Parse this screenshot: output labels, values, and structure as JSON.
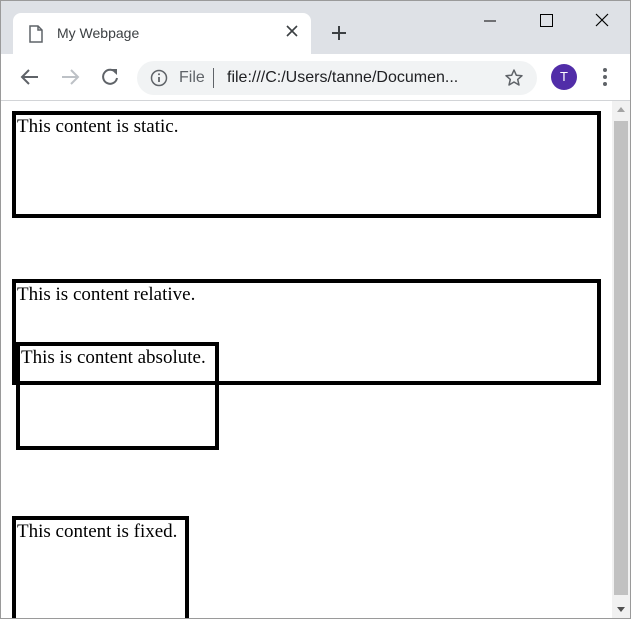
{
  "tab": {
    "title": "My Webpage",
    "page_icon": "page-icon",
    "close_icon": "close-icon"
  },
  "new_tab_icon": "plus-icon",
  "window_controls": [
    "minimize-icon",
    "maximize-icon",
    "close-icon"
  ],
  "toolbar": {
    "back_icon": "back-arrow-icon",
    "forward_icon": "forward-arrow-icon",
    "reload_icon": "reload-icon",
    "omnibox": {
      "info_icon": "info-icon",
      "scheme_label": "File",
      "url": "file:///C:/Users/tanne/Documen...",
      "bookmark_icon": "star-icon"
    },
    "avatar_initial": "T",
    "menu_icon": "three-dot-menu-icon"
  },
  "colors": {
    "avatar": "#512da8",
    "titlebar": "#dee1e6",
    "omnibox": "#f1f3f4"
  },
  "page": {
    "static_text": "This content is static.",
    "relative_text": "This is content relative.",
    "absolute_text": "This is content absolute.",
    "fixed_text": "This content is fixed."
  }
}
